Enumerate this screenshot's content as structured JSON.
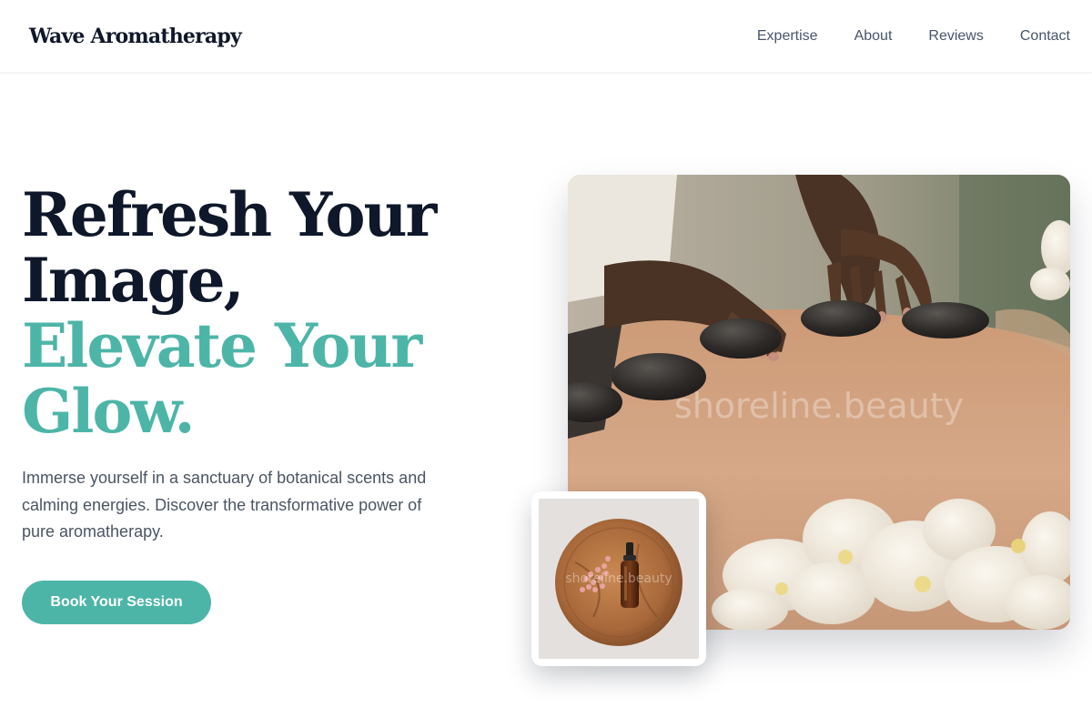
{
  "brand": {
    "name": "Wave Aromatherapy"
  },
  "nav": {
    "items": [
      {
        "label": "Expertise"
      },
      {
        "label": "About"
      },
      {
        "label": "Reviews"
      },
      {
        "label": "Contact"
      }
    ]
  },
  "hero": {
    "title_line1": "Refresh Your",
    "title_line2": "Image,",
    "title_line3": "Elevate Your",
    "title_line4": "Glow.",
    "description": "Immerse yourself in a sanctuary of botanical scents and calming energies. Discover the transformative power of pure aromatherapy.",
    "cta_label": "Book Your Session"
  },
  "images": {
    "main_watermark": "shoreline.beauty",
    "inset_watermark": "shoreline.beauty"
  },
  "colors": {
    "accent": "#4db5a8",
    "heading": "#0f172a",
    "body_text": "#4b5563",
    "nav_text": "#475569"
  }
}
